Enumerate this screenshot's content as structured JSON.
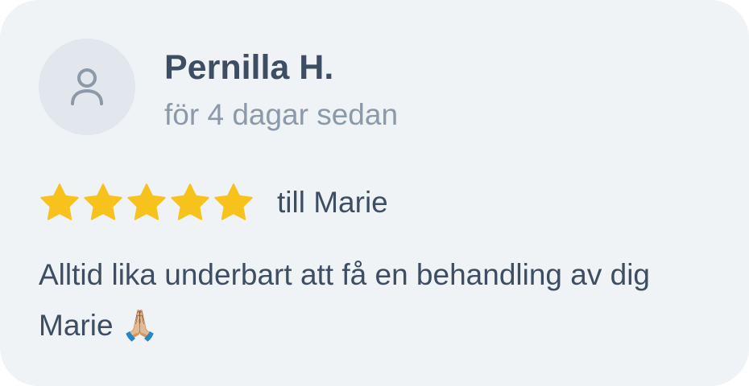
{
  "review": {
    "reviewer_name": "Pernilla H.",
    "time_ago": "för 4 dagar sedan",
    "rating": 5,
    "rating_max": 5,
    "recipient": "till Marie",
    "text": "Alltid lika underbart att få en behandling av dig Marie 🙏🏼"
  },
  "icons": {
    "avatar": "user-icon",
    "rating": "star-icon"
  },
  "colors": {
    "card_background": "#eff3f6",
    "avatar_background": "#e1e7ec",
    "name_text": "#3d4e63",
    "muted_text": "#8b99a8",
    "star": "#f8c21d"
  }
}
